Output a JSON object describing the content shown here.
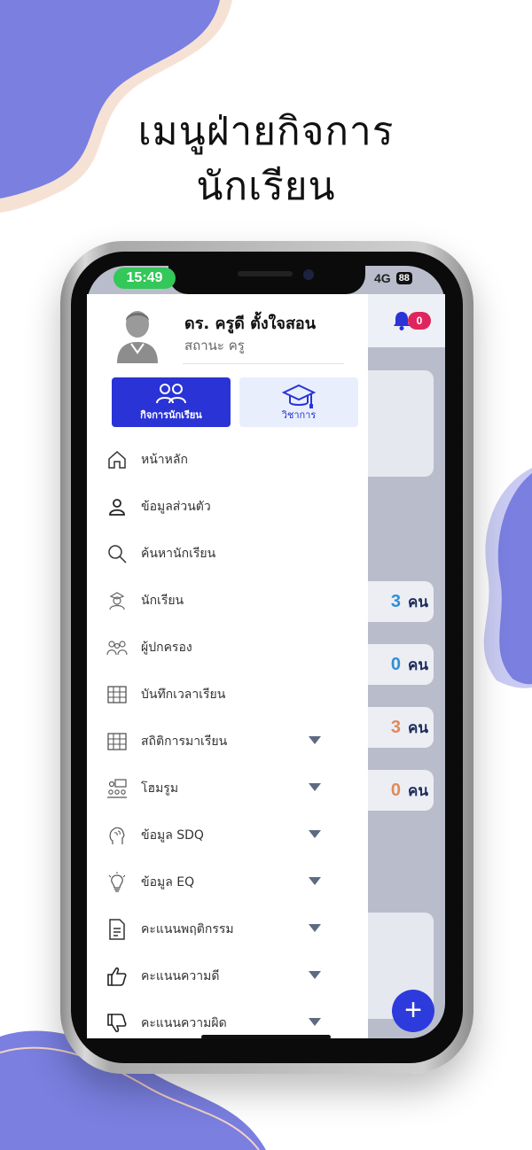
{
  "promo": {
    "headline_line1": "เมนูฝ่ายกิจการ",
    "headline_line2": "นักเรียน"
  },
  "colors": {
    "accent": "#2a33d6",
    "blob": "#7a7fe0",
    "badge": "#e0245e",
    "fab": "#2e3bdc"
  },
  "status_bar": {
    "time": "15:49",
    "network": "4G",
    "battery": "88"
  },
  "header": {
    "notification_count": "0"
  },
  "profile": {
    "name": "ดร. ครูดี ตั้งใจสอน",
    "role": "สถานะ ครู"
  },
  "tabs": [
    {
      "label": "กิจการนักเรียน",
      "icon": "students-icon",
      "active": true
    },
    {
      "label": "วิชาการ",
      "icon": "graduation-cap-icon",
      "active": false
    }
  ],
  "menu": [
    {
      "label": "หน้าหลัก",
      "icon": "home-icon",
      "expandable": false
    },
    {
      "label": "ข้อมูลส่วนตัว",
      "icon": "person-icon",
      "expandable": false
    },
    {
      "label": "ค้นหานักเรียน",
      "icon": "search-icon",
      "expandable": false
    },
    {
      "label": "นักเรียน",
      "icon": "student-icon",
      "expandable": false
    },
    {
      "label": "ผู้ปกครอง",
      "icon": "parents-icon",
      "expandable": false
    },
    {
      "label": "บันทึกเวลาเรียน",
      "icon": "table-icon",
      "expandable": false
    },
    {
      "label": "สถิติการมาเรียน",
      "icon": "table-icon",
      "expandable": true
    },
    {
      "label": "โฮมรูม",
      "icon": "homeroom-icon",
      "expandable": true
    },
    {
      "label": "ข้อมูล SDQ",
      "icon": "brain-icon",
      "expandable": true
    },
    {
      "label": "ข้อมูล EQ",
      "icon": "lightbulb-icon",
      "expandable": true
    },
    {
      "label": "คะแนนพฤติกรรม",
      "icon": "document-icon",
      "expandable": true
    },
    {
      "label": "คะแนนความดี",
      "icon": "thumbs-up-icon",
      "expandable": true
    },
    {
      "label": "คะแนนความผิด",
      "icon": "thumbs-down-icon",
      "expandable": true
    }
  ],
  "stats": [
    {
      "value": "3",
      "unit": "คน",
      "color": "#2f8fd6"
    },
    {
      "value": "0",
      "unit": "คน",
      "color": "#2f8fd6"
    },
    {
      "value": "3",
      "unit": "คน",
      "color": "#e08a5a"
    },
    {
      "value": "0",
      "unit": "คน",
      "color": "#e08a5a"
    }
  ],
  "fab": {
    "icon": "plus-icon",
    "label": "+"
  }
}
